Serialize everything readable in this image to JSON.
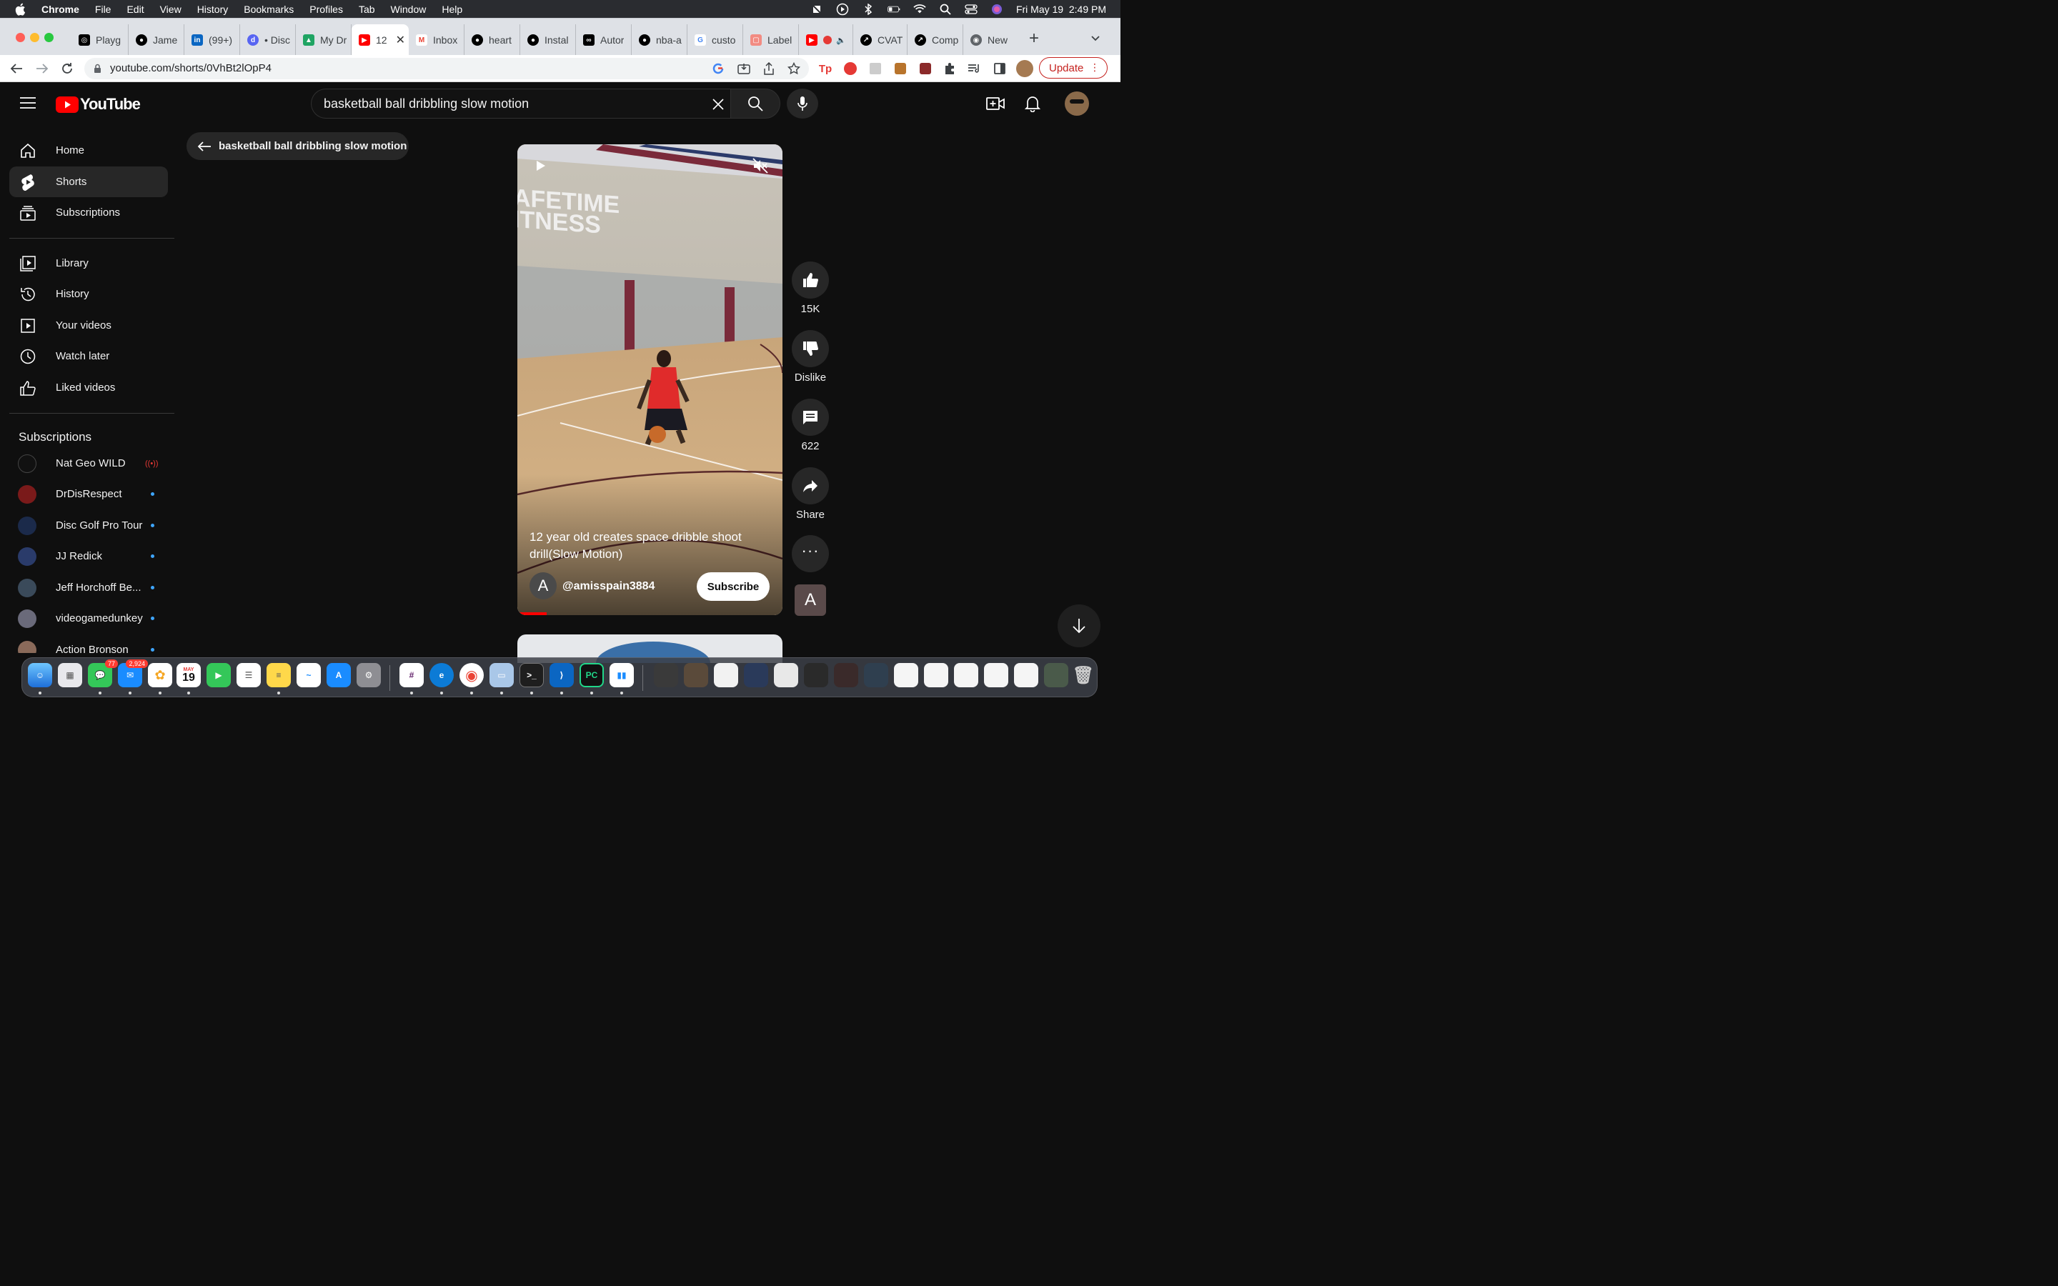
{
  "menubar": {
    "app": "Chrome",
    "items": [
      "File",
      "Edit",
      "View",
      "History",
      "Bookmarks",
      "Profiles",
      "Tab",
      "Window",
      "Help"
    ],
    "datetime": "Fri May 19  2:49 PM"
  },
  "tabs": [
    {
      "title": "Playg",
      "icon": "openai-icon",
      "color": "#000000"
    },
    {
      "title": "Jame",
      "icon": "github-icon",
      "color": "#000000"
    },
    {
      "title": "(99+)",
      "icon": "linkedin-icon",
      "color": "#0a66c2"
    },
    {
      "title": "• Disc",
      "icon": "discord-icon",
      "color": "#5865f2"
    },
    {
      "title": "My Dr",
      "icon": "drive-icon",
      "color": "#1fa463"
    },
    {
      "title": "12",
      "icon": "youtube-icon",
      "color": "#ff0000",
      "active": true
    },
    {
      "title": "Inbox",
      "icon": "gmail-icon",
      "color": "#ea4335"
    },
    {
      "title": "heart",
      "icon": "github-icon",
      "color": "#000000"
    },
    {
      "title": "Instal",
      "icon": "github-icon",
      "color": "#000000"
    },
    {
      "title": "Autor",
      "icon": "app-icon",
      "color": "#000000"
    },
    {
      "title": "nba-a",
      "icon": "github-icon",
      "color": "#000000"
    },
    {
      "title": "custo",
      "icon": "google-icon",
      "color": "#4285f4"
    },
    {
      "title": "Label",
      "icon": "label-icon",
      "color": "#f28b82"
    },
    {
      "title": "",
      "icon": "youtube-icon",
      "color": "#ff0000"
    },
    {
      "title": "CVAT",
      "icon": "cvat-icon",
      "color": "#000000"
    },
    {
      "title": "Comp",
      "icon": "cvat-icon",
      "color": "#000000"
    },
    {
      "title": "New",
      "icon": "chrome-icon",
      "color": "#5f6368"
    }
  ],
  "address": {
    "url": "youtube.com/shorts/0VhBt2lOpP4"
  },
  "update_label": "Update",
  "youtube": {
    "logo_text": "YouTube",
    "search_value": "basketball ball dribbling slow motion",
    "back_chip_label": "basketball ball dribbling slow motion"
  },
  "sidebar": {
    "main": [
      {
        "label": "Home",
        "icon": "home-icon"
      },
      {
        "label": "Shorts",
        "icon": "shorts-icon",
        "active": true
      },
      {
        "label": "Subscriptions",
        "icon": "subscriptions-icon"
      }
    ],
    "library": [
      {
        "label": "Library",
        "icon": "library-icon"
      },
      {
        "label": "History",
        "icon": "history-icon"
      },
      {
        "label": "Your videos",
        "icon": "your-videos-icon"
      },
      {
        "label": "Watch later",
        "icon": "watch-later-icon"
      },
      {
        "label": "Liked videos",
        "icon": "liked-videos-icon"
      }
    ],
    "subscriptions_heading": "Subscriptions",
    "subscriptions": [
      {
        "label": "Nat Geo WILD",
        "status": "live",
        "avatar_color": "#111111"
      },
      {
        "label": "DrDisRespect",
        "status": "new",
        "avatar_color": "#7a1a1a"
      },
      {
        "label": "Disc Golf Pro Tour",
        "status": "new",
        "avatar_color": "#1b2a4a"
      },
      {
        "label": "JJ Redick",
        "status": "new",
        "avatar_color": "#2a3b6a"
      },
      {
        "label": "Jeff Horchoff Be...",
        "status": "new",
        "avatar_color": "#3a4a5a"
      },
      {
        "label": "videogamedunkey",
        "status": "new",
        "avatar_color": "#6a6a7a"
      },
      {
        "label": "Action Bronson",
        "status": "new",
        "avatar_color": "#8a6a5a"
      }
    ]
  },
  "short": {
    "title": "12 year old creates space dribble shoot drill(Slow Motion)",
    "channel_initial": "A",
    "channel_handle": "@amisspain3884",
    "subscribe_label": "Subscribe",
    "overlay_text": "AFETIME\nITNESS",
    "progress": 0.11
  },
  "actions": {
    "likes": "15K",
    "dislike_label": "Dislike",
    "comments": "622",
    "share_label": "Share",
    "channel_initial": "A"
  },
  "dock": {
    "messages_badge": "77",
    "mail_badge": "2,924",
    "calendar_month": "MAY",
    "calendar_day": "19"
  }
}
